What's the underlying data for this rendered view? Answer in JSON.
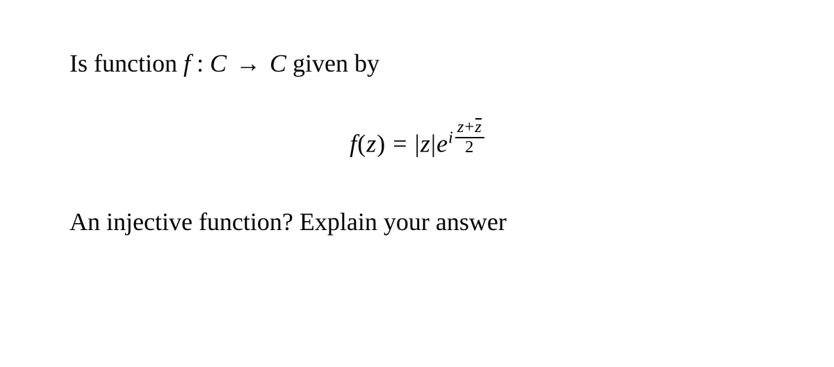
{
  "line1": {
    "prefix": "Is function ",
    "f": "f",
    "colon": " : ",
    "C1": "C",
    "space1": "  ",
    "arrow": "→",
    "space2": " ",
    "C2": "C",
    "suffix": " given by"
  },
  "equation": {
    "fz": "f",
    "open": "(",
    "z1": "z",
    "close": ")",
    "eq": " = ",
    "bar1": "|",
    "z2": "z",
    "bar2": "|",
    "e": "e",
    "i": "i",
    "num_z": "z",
    "plus": "+",
    "num_zbar": "z",
    "den": "2"
  },
  "line3": {
    "text": "An injective function? Explain your answer"
  }
}
